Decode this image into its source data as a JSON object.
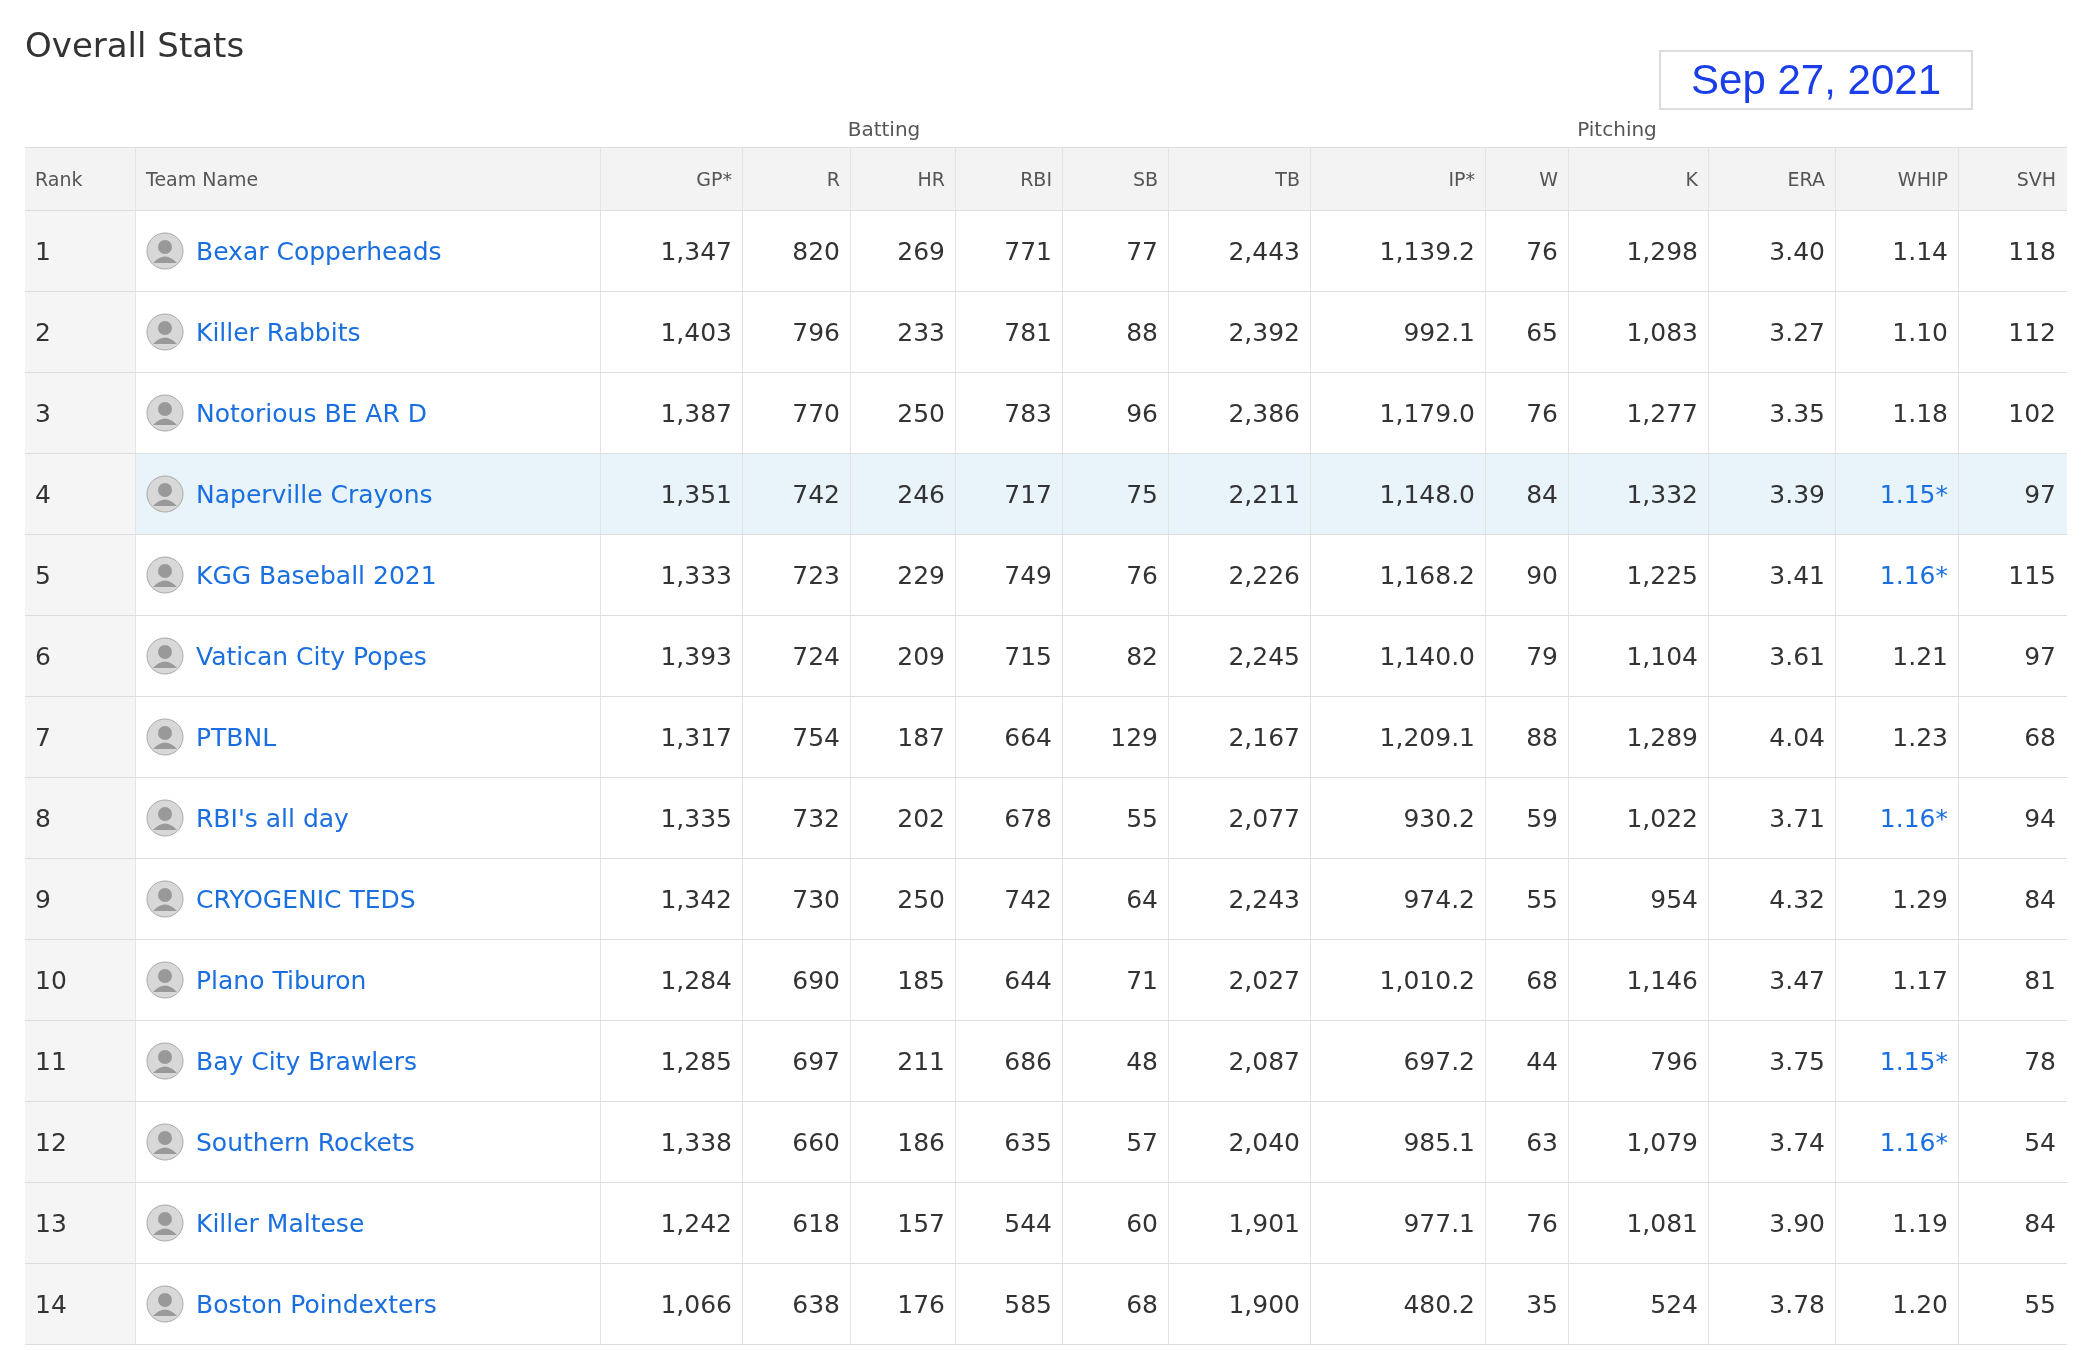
{
  "title": "Overall Stats",
  "date": "Sep 27, 2021",
  "groups": [
    {
      "label": "Batting"
    },
    {
      "label": "Pitching"
    }
  ],
  "columns": [
    "Rank",
    "Team Name",
    "GP*",
    "R",
    "HR",
    "RBI",
    "SB",
    "TB",
    "IP*",
    "W",
    "K",
    "ERA",
    "WHIP",
    "SVH"
  ],
  "rows": [
    {
      "selected": false,
      "rank": "1",
      "team": "Bexar Copperheads",
      "stats": [
        "1,347",
        "820",
        "269",
        "771",
        "77",
        "2,443",
        "1,139.2",
        "76",
        "1,298",
        "3.40"
      ],
      "whip": {
        "text": "1.14",
        "link": false
      },
      "svh": "118"
    },
    {
      "selected": false,
      "rank": "2",
      "team": "Killer Rabbits",
      "stats": [
        "1,403",
        "796",
        "233",
        "781",
        "88",
        "2,392",
        "992.1",
        "65",
        "1,083",
        "3.27"
      ],
      "whip": {
        "text": "1.10",
        "link": false
      },
      "svh": "112"
    },
    {
      "selected": false,
      "rank": "3",
      "team": "Notorious BE AR D",
      "stats": [
        "1,387",
        "770",
        "250",
        "783",
        "96",
        "2,386",
        "1,179.0",
        "76",
        "1,277",
        "3.35"
      ],
      "whip": {
        "text": "1.18",
        "link": false
      },
      "svh": "102"
    },
    {
      "selected": true,
      "rank": "4",
      "team": "Naperville Crayons",
      "stats": [
        "1,351",
        "742",
        "246",
        "717",
        "75",
        "2,211",
        "1,148.0",
        "84",
        "1,332",
        "3.39"
      ],
      "whip": {
        "text": "1.15*",
        "link": true
      },
      "svh": "97"
    },
    {
      "selected": false,
      "rank": "5",
      "team": "KGG Baseball 2021",
      "stats": [
        "1,333",
        "723",
        "229",
        "749",
        "76",
        "2,226",
        "1,168.2",
        "90",
        "1,225",
        "3.41"
      ],
      "whip": {
        "text": "1.16*",
        "link": true
      },
      "svh": "115"
    },
    {
      "selected": false,
      "rank": "6",
      "team": "Vatican City Popes",
      "stats": [
        "1,393",
        "724",
        "209",
        "715",
        "82",
        "2,245",
        "1,140.0",
        "79",
        "1,104",
        "3.61"
      ],
      "whip": {
        "text": "1.21",
        "link": false
      },
      "svh": "97"
    },
    {
      "selected": false,
      "rank": "7",
      "team": "PTBNL",
      "stats": [
        "1,317",
        "754",
        "187",
        "664",
        "129",
        "2,167",
        "1,209.1",
        "88",
        "1,289",
        "4.04"
      ],
      "whip": {
        "text": "1.23",
        "link": false
      },
      "svh": "68"
    },
    {
      "selected": false,
      "rank": "8",
      "team": "RBI's all day",
      "stats": [
        "1,335",
        "732",
        "202",
        "678",
        "55",
        "2,077",
        "930.2",
        "59",
        "1,022",
        "3.71"
      ],
      "whip": {
        "text": "1.16*",
        "link": true
      },
      "svh": "94"
    },
    {
      "selected": false,
      "rank": "9",
      "team": "CRYOGENIC TEDS",
      "stats": [
        "1,342",
        "730",
        "250",
        "742",
        "64",
        "2,243",
        "974.2",
        "55",
        "954",
        "4.32"
      ],
      "whip": {
        "text": "1.29",
        "link": false
      },
      "svh": "84"
    },
    {
      "selected": false,
      "rank": "10",
      "team": "Plano Tiburon",
      "stats": [
        "1,284",
        "690",
        "185",
        "644",
        "71",
        "2,027",
        "1,010.2",
        "68",
        "1,146",
        "3.47"
      ],
      "whip": {
        "text": "1.17",
        "link": false
      },
      "svh": "81"
    },
    {
      "selected": false,
      "rank": "11",
      "team": "Bay City Brawlers",
      "stats": [
        "1,285",
        "697",
        "211",
        "686",
        "48",
        "2,087",
        "697.2",
        "44",
        "796",
        "3.75"
      ],
      "whip": {
        "text": "1.15*",
        "link": true
      },
      "svh": "78"
    },
    {
      "selected": false,
      "rank": "12",
      "team": "Southern Rockets",
      "stats": [
        "1,338",
        "660",
        "186",
        "635",
        "57",
        "2,040",
        "985.1",
        "63",
        "1,079",
        "3.74"
      ],
      "whip": {
        "text": "1.16*",
        "link": true
      },
      "svh": "54"
    },
    {
      "selected": false,
      "rank": "13",
      "team": "Killer Maltese",
      "stats": [
        "1,242",
        "618",
        "157",
        "544",
        "60",
        "1,901",
        "977.1",
        "76",
        "1,081",
        "3.90"
      ],
      "whip": {
        "text": "1.19",
        "link": false
      },
      "svh": "84"
    },
    {
      "selected": false,
      "rank": "14",
      "team": "Boston Poindexters",
      "stats": [
        "1,066",
        "638",
        "176",
        "585",
        "68",
        "1,900",
        "480.2",
        "35",
        "524",
        "3.78"
      ],
      "whip": {
        "text": "1.20",
        "link": false
      },
      "svh": "55"
    }
  ]
}
